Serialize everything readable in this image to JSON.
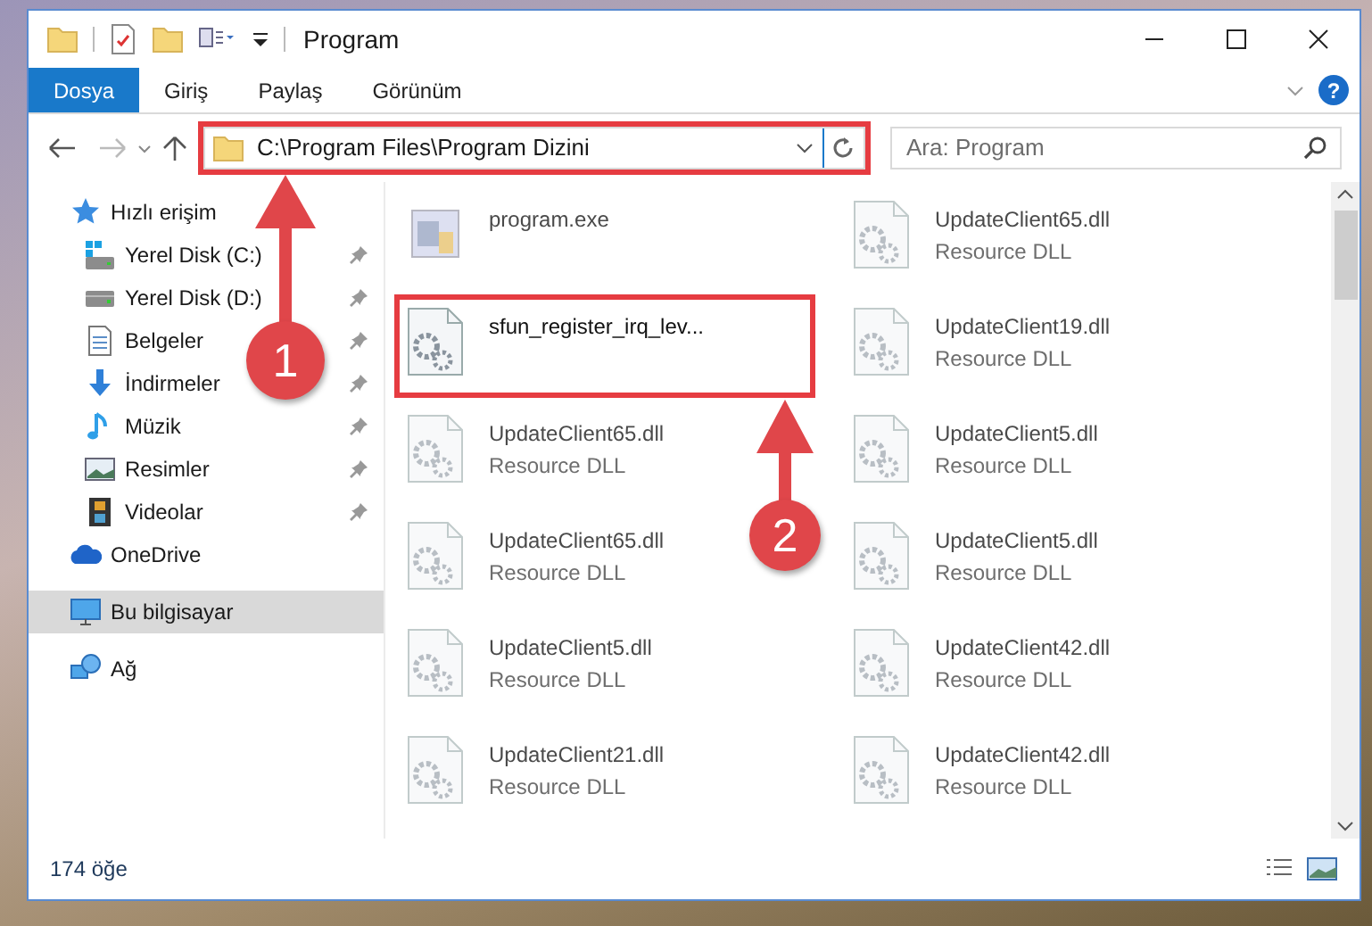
{
  "window": {
    "title": "Program"
  },
  "ribbon_tabs": [
    {
      "label": "Dosya",
      "selected": true
    },
    {
      "label": "Giriş",
      "selected": false
    },
    {
      "label": "Paylaş",
      "selected": false
    },
    {
      "label": "Görünüm",
      "selected": false
    }
  ],
  "help_button": {
    "label": "?"
  },
  "address": {
    "path": "C:\\Program Files\\Program Dizini",
    "highlighted": true
  },
  "search": {
    "placeholder": "Ara: Program"
  },
  "sidebar": {
    "items": [
      {
        "label": "Hızlı erişim",
        "selected": false,
        "children": [
          {
            "label": "Yerel Disk (C:)",
            "pinned": true,
            "selected": false
          },
          {
            "label": "Yerel Disk (D:)",
            "pinned": true,
            "selected": false
          },
          {
            "label": "Belgeler",
            "pinned": true,
            "selected": false
          },
          {
            "label": "İndirmeler",
            "pinned": true,
            "selected": false
          },
          {
            "label": "Müzik",
            "pinned": true,
            "selected": false
          },
          {
            "label": "Resimler",
            "pinned": true,
            "selected": false
          },
          {
            "label": "Videolar",
            "pinned": true,
            "selected": false
          }
        ]
      },
      {
        "label": "OneDrive",
        "selected": false
      },
      {
        "label": "Bu bilgisayar",
        "selected": true
      },
      {
        "label": "Ağ",
        "selected": false
      }
    ]
  },
  "files": [
    {
      "name": "program.exe",
      "kind": "exe",
      "dimmed": true,
      "highlighted": false
    },
    {
      "name": "UpdateClient65.dll",
      "type": "Resource DLL",
      "kind": "dll",
      "dimmed": true,
      "highlighted": false
    },
    {
      "name": "sfun_register_irq_lev...",
      "kind": "dll",
      "dimmed": false,
      "highlighted": true
    },
    {
      "name": "UpdateClient19.dll",
      "type": "Resource DLL",
      "kind": "dll",
      "dimmed": true,
      "highlighted": false
    },
    {
      "name": "UpdateClient65.dll",
      "type": "Resource DLL",
      "kind": "dll",
      "dimmed": true,
      "highlighted": false
    },
    {
      "name": "UpdateClient5.dll",
      "type": "Resource DLL",
      "kind": "dll",
      "dimmed": true,
      "highlighted": false
    },
    {
      "name": "UpdateClient65.dll",
      "type": "Resource DLL",
      "kind": "dll",
      "dimmed": true,
      "highlighted": false
    },
    {
      "name": "UpdateClient5.dll",
      "type": "Resource DLL",
      "kind": "dll",
      "dimmed": true,
      "highlighted": false
    },
    {
      "name": "UpdateClient5.dll",
      "type": "Resource DLL",
      "kind": "dll",
      "dimmed": true,
      "highlighted": false
    },
    {
      "name": "UpdateClient42.dll",
      "type": "Resource DLL",
      "kind": "dll",
      "dimmed": true,
      "highlighted": false
    },
    {
      "name": "UpdateClient21.dll",
      "type": "Resource DLL",
      "kind": "dll",
      "dimmed": true,
      "highlighted": false
    },
    {
      "name": "UpdateClient42.dll",
      "type": "Resource DLL",
      "kind": "dll",
      "dimmed": true,
      "highlighted": false
    }
  ],
  "status_bar": {
    "count": "174 öğe"
  },
  "callouts": [
    {
      "number": "1"
    },
    {
      "number": "2"
    }
  ]
}
